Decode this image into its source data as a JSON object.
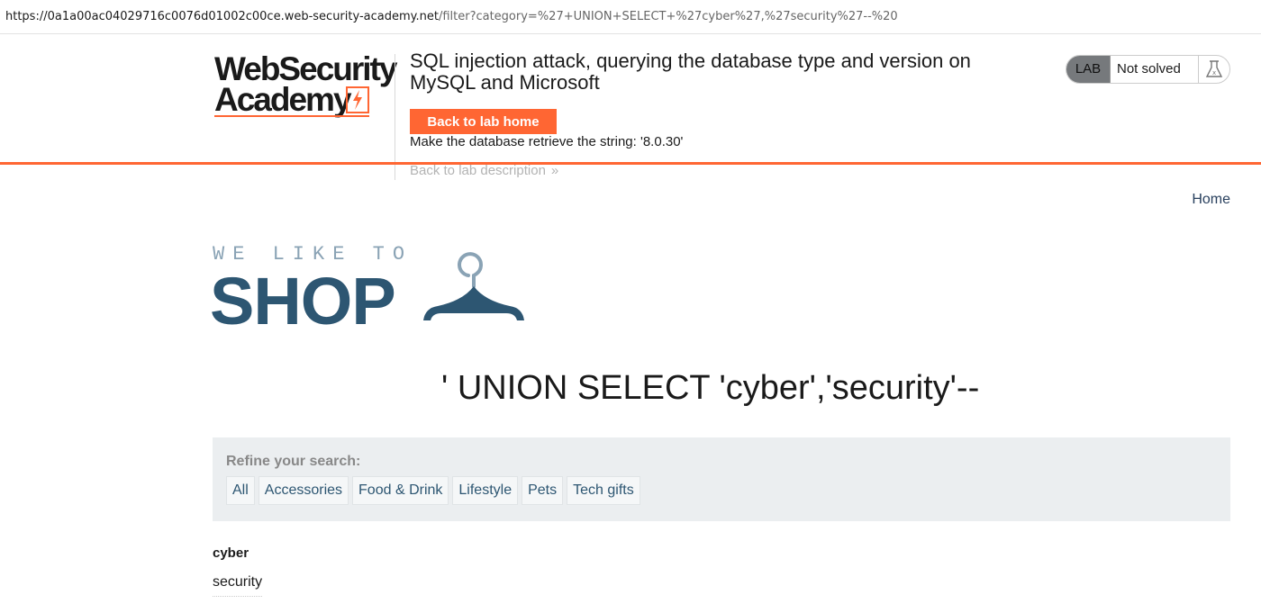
{
  "browser": {
    "url_host": "https://0a1a00ac04029716c0076d01002c00ce.web-security-academy.net",
    "url_rest": "/filter?category=%27+UNION+SELECT+%27cyber%27,%27security%27--%20"
  },
  "lab_header": {
    "logo_line1": "WebSecurity",
    "logo_line2": "Academy",
    "title": "SQL injection attack, querying the database type and version on MySQL and Microsoft",
    "back_button": "Back to lab home",
    "instruction": "Make the database retrieve the string: '8.0.30'",
    "back_description": "Back to lab description",
    "back_description_chevron": "»",
    "status_badge": "LAB",
    "status_text": "Not solved",
    "status_icon": "flask-icon",
    "accent_color": "#ff6633"
  },
  "shop": {
    "home_link": "Home",
    "logo_tagline": "WE LIKE TO",
    "logo_word": "SHOP",
    "logo_icon": "hanger-icon",
    "heading": "' UNION SELECT 'cyber','security'--",
    "refine_label": "Refine your search:",
    "categories": [
      "All",
      "Accessories",
      "Food & Drink",
      "Lifestyle",
      "Pets",
      "Tech gifts"
    ],
    "results": {
      "row1": "cyber",
      "row2": "security"
    }
  }
}
